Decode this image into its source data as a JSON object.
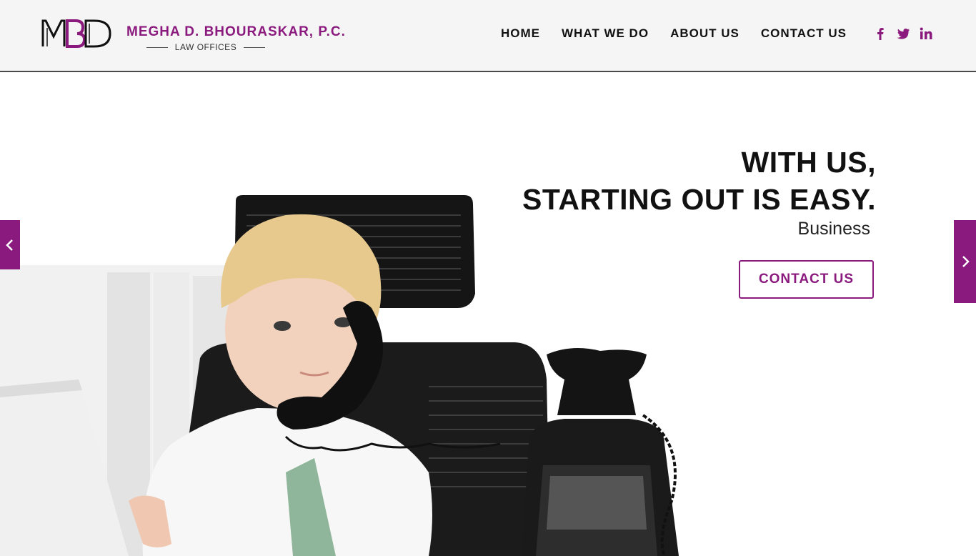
{
  "brand": {
    "name": "MEGHA D. BHOURASKAR, P.C.",
    "subtitle": "LAW OFFICES",
    "logo_text": "MBD",
    "accent_color": "#8b1a7e"
  },
  "nav": {
    "items": [
      {
        "label": "HOME"
      },
      {
        "label": "WHAT WE DO"
      },
      {
        "label": "ABOUT US"
      },
      {
        "label": "CONTACT US"
      }
    ]
  },
  "social": {
    "icons": [
      "facebook-icon",
      "twitter-icon",
      "linkedin-icon"
    ]
  },
  "hero": {
    "headline_line1": "WITH US,",
    "headline_line2": "STARTING OUT IS EASY.",
    "subline": "Business",
    "cta_label": "CONTACT US",
    "prev_icon": "chevron-left-icon",
    "next_icon": "chevron-right-icon"
  }
}
